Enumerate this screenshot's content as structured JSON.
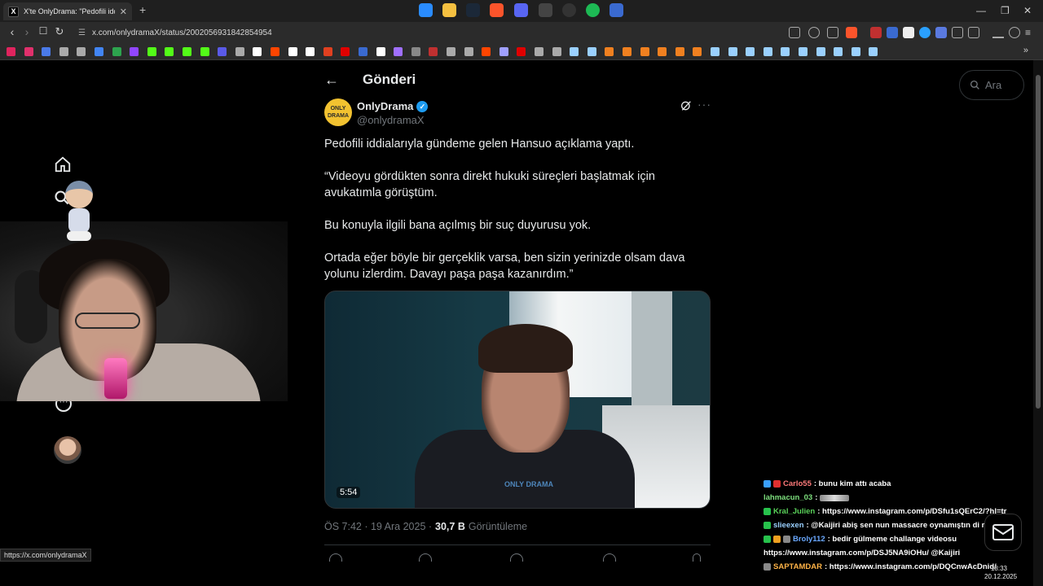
{
  "browser": {
    "tab_title": "X'te OnlyDrama: \"Pedofili idd",
    "tab_favicon": "X",
    "tab_close": "✕",
    "new_tab": "+",
    "url": "x.com/onlydramaX/status/2002056931842854954",
    "status_tip": "https://x.com/onlydramaX",
    "window_controls": [
      "—",
      "❐",
      "✕"
    ]
  },
  "x": {
    "header_title": "Gönderi",
    "search_placeholder": "Ara",
    "author": {
      "name": "OnlyDrama",
      "handle": "@onlydramaX",
      "avatar_text": "ONLY DRAMA",
      "verified": true
    },
    "tweet_paragraphs": [
      "Pedofili iddialarıyla gündeme gelen Hansuo açıklama yaptı.",
      "“Videoyu gördükten sonra direkt hukuki süreçleri başlatmak için avukatımla görüştüm.",
      "Bu konuyla ilgili bana açılmış bir suç duyurusu yok.",
      "Ortada eğer böyle bir gerçeklik varsa, ben sizin yerinizde olsam dava yolunu izlerdim. Davayı paşa paşa kazanırdım.”"
    ],
    "video_duration": "5:54",
    "video_watermark": "ONLY DRAMA",
    "meta_time": "ÖS 7:42 · 19 Ara 2025 ·",
    "meta_views_count": "30,7 B",
    "meta_views_label": "Görüntüleme",
    "accent": "#1d9bf0"
  },
  "chat": [
    {
      "user": "Carlo55",
      "color": "#ff7a7a",
      "msg": ": bunu kim attı acaba",
      "badges": [
        "#3aa0ff",
        "#e03030"
      ]
    },
    {
      "user": "lahmacun_03",
      "color": "#7ee07e",
      "msg": ":",
      "emote": true,
      "badges": []
    },
    {
      "user": "Kral_Julien",
      "color": "#5ad25a",
      "msg": ": https://www.instagram.com/p/DSfu1sQErC2/?hl=tr",
      "badges": [
        "#27c24c"
      ]
    },
    {
      "user": "slieexen",
      "color": "#9ad0ff",
      "msg": ": @Kaijiri abiş sen nun massacre oynamıştın di mi",
      "badges": [
        "#27c24c"
      ]
    },
    {
      "user": "Broly112",
      "color": "#6aa8ff",
      "msg": ": bedir gülmeme challange videosu",
      "badges": [
        "#27c24c",
        "#f0a020",
        "#888"
      ]
    },
    {
      "user": "",
      "color": "#ffffff",
      "msg": "https://www.instagram.com/p/DSJ5NA9iOHu/ @Kaijiri",
      "badges": []
    },
    {
      "user": "SAPTAMDAR",
      "color": "#ffb347",
      "msg": ": https://www.instagram.com/p/DQCnwAcDnid/",
      "badges": [
        "#888"
      ]
    }
  ],
  "system": {
    "clock_time": "18:33",
    "clock_date": "20.12.2025"
  }
}
